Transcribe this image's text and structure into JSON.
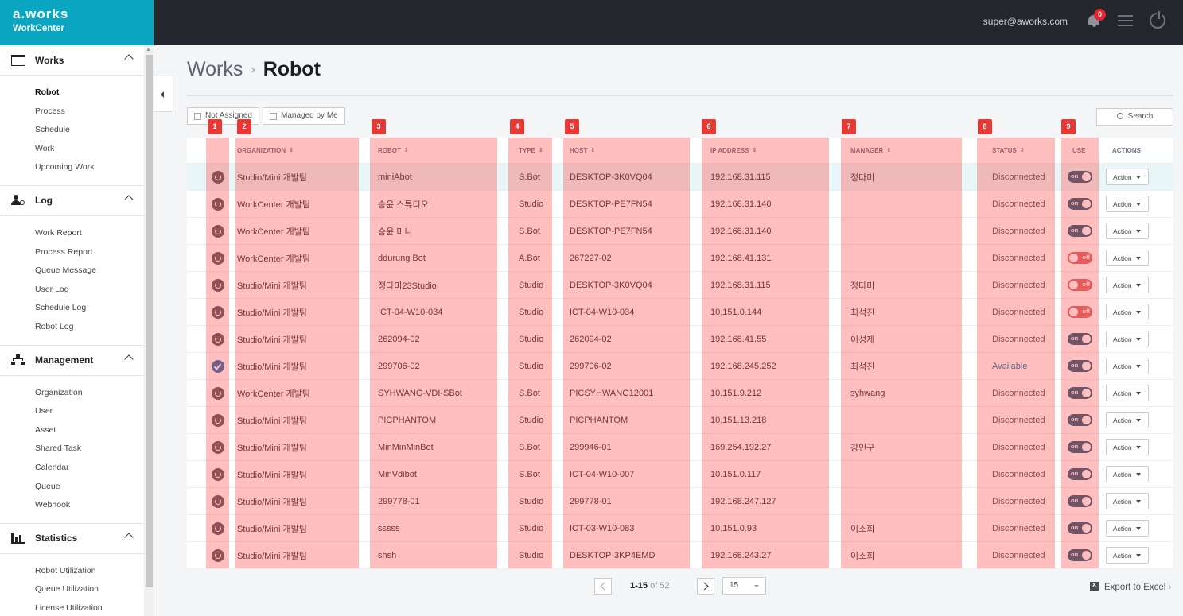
{
  "brand": {
    "logo": "a.works",
    "sub": "WorkCenter"
  },
  "topbar": {
    "email": "super@aworks.com",
    "notification_count": "0"
  },
  "sidebar": {
    "sections": [
      {
        "title": "Works",
        "icon": "calendar-icon",
        "items": [
          "Robot",
          "Process",
          "Schedule",
          "Work",
          "Upcoming Work"
        ],
        "active": "Robot"
      },
      {
        "title": "Log",
        "icon": "user-gear-icon",
        "items": [
          "Work Report",
          "Process Report",
          "Queue Message",
          "User Log",
          "Schedule Log",
          "Robot Log"
        ]
      },
      {
        "title": "Management",
        "icon": "org-chart-icon",
        "items": [
          "Organization",
          "User",
          "Asset",
          "Shared Task",
          "Calendar",
          "Queue",
          "Webhook"
        ]
      },
      {
        "title": "Statistics",
        "icon": "bar-chart-icon",
        "items": [
          "Robot Utilization",
          "Queue Utilization",
          "License Utilization"
        ]
      }
    ]
  },
  "breadcrumb": {
    "parent": "Works",
    "current": "Robot"
  },
  "filters": {
    "not_assigned": "Not Assigned",
    "managed_by_me": "Managed by Me",
    "search": "Search"
  },
  "table": {
    "columns": [
      "ORGANIZATION",
      "ROBOT",
      "TYPE",
      "HOST",
      "IP ADDRESS",
      "MANAGER",
      "STATUS",
      "USE",
      "ACTIONS"
    ],
    "action_label": "Action",
    "toggle_on": "on",
    "toggle_off": "off",
    "rows": [
      {
        "org": "Studio/Mini 개발팀",
        "robot": "miniAbot",
        "type": "S.Bot",
        "host": "DESKTOP-3K0VQ04",
        "ip": "192.168.31.115",
        "manager": "정다미",
        "status": "Disconnected",
        "use": true
      },
      {
        "org": "WorkCenter 개발팀",
        "robot": "승윤 스튜디오",
        "type": "Studio",
        "host": "DESKTOP-PE7FN54",
        "ip": "192.168.31.140",
        "manager": "",
        "status": "Disconnected",
        "use": true
      },
      {
        "org": "WorkCenter 개발팀",
        "robot": "승윤 미니",
        "type": "S.Bot",
        "host": "DESKTOP-PE7FN54",
        "ip": "192.168.31.140",
        "manager": "",
        "status": "Disconnected",
        "use": true
      },
      {
        "org": "WorkCenter 개발팀",
        "robot": "ddurung Bot",
        "type": "A.Bot",
        "host": "267227-02",
        "ip": "192.168.41.131",
        "manager": "",
        "status": "Disconnected",
        "use": false
      },
      {
        "org": "Studio/Mini 개발팀",
        "robot": "정다미23Studio",
        "type": "Studio",
        "host": "DESKTOP-3K0VQ04",
        "ip": "192.168.31.115",
        "manager": "정다미",
        "status": "Disconnected",
        "use": false
      },
      {
        "org": "Studio/Mini 개발팀",
        "robot": "ICT-04-W10-034",
        "type": "Studio",
        "host": "ICT-04-W10-034",
        "ip": "10.151.0.144",
        "manager": "최석진",
        "status": "Disconnected",
        "use": false
      },
      {
        "org": "Studio/Mini 개발팀",
        "robot": "262094-02",
        "type": "Studio",
        "host": "262094-02",
        "ip": "192.168.41.55",
        "manager": "이성제",
        "status": "Disconnected",
        "use": true
      },
      {
        "org": "Studio/Mini 개발팀",
        "robot": "299706-02",
        "type": "Studio",
        "host": "299706-02",
        "ip": "192.168.245.252",
        "manager": "최석진",
        "status": "Available",
        "use": true
      },
      {
        "org": "WorkCenter 개발팀",
        "robot": "SYHWANG-VDI-SBot",
        "type": "S.Bot",
        "host": "PICSYHWANG12001",
        "ip": "10.151.9.212",
        "manager": "syhwang",
        "status": "Disconnected",
        "use": true
      },
      {
        "org": "Studio/Mini 개발팀",
        "robot": "PICPHANTOM",
        "type": "Studio",
        "host": "PICPHANTOM",
        "ip": "10.151.13.218",
        "manager": "",
        "status": "Disconnected",
        "use": true
      },
      {
        "org": "Studio/Mini 개발팀",
        "robot": "MinMinMinBot",
        "type": "S.Bot",
        "host": "299946-01",
        "ip": "169.254.192.27",
        "manager": "강민구",
        "status": "Disconnected",
        "use": true
      },
      {
        "org": "Studio/Mini 개발팀",
        "robot": "MinVdibot",
        "type": "S.Bot",
        "host": "ICT-04-W10-007",
        "ip": "10.151.0.117",
        "manager": "",
        "status": "Disconnected",
        "use": true
      },
      {
        "org": "Studio/Mini 개발팀",
        "robot": "299778-01",
        "type": "Studio",
        "host": "299778-01",
        "ip": "192.168.247.127",
        "manager": "",
        "status": "Disconnected",
        "use": true
      },
      {
        "org": "Studio/Mini 개발팀",
        "robot": "sssss",
        "type": "Studio",
        "host": "ICT-03-W10-083",
        "ip": "10.151.0.93",
        "manager": "이소희",
        "status": "Disconnected",
        "use": true
      },
      {
        "org": "Studio/Mini 개발팀",
        "robot": "shsh",
        "type": "Studio",
        "host": "DESKTOP-3KP4EMD",
        "ip": "192.168.243.27",
        "manager": "이소희",
        "status": "Disconnected",
        "use": true
      }
    ]
  },
  "annotation_tags": [
    "1",
    "2",
    "3",
    "4",
    "5",
    "6",
    "7",
    "8",
    "9"
  ],
  "pagination": {
    "range": "1-15",
    "of": "of 52",
    "page_size": "15"
  },
  "export_label": "Export to Excel",
  "colors": {
    "brand": "#0aa6c1",
    "topbar": "#23262d",
    "available": "#1a7fa0",
    "disconnected": "#555555",
    "toggle_on": "#2c5f7d"
  }
}
